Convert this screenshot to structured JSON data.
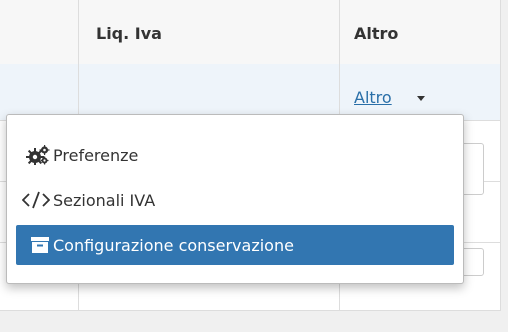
{
  "table": {
    "columns": [
      "Liq. Iva",
      "Altro"
    ]
  },
  "row_action": {
    "label": "Altro"
  },
  "menu": {
    "items": [
      {
        "label": "Preferenze",
        "icon": "cogs-icon"
      },
      {
        "label": "Sezionali IVA",
        "icon": "code-icon"
      },
      {
        "label": "Configurazione conservazione",
        "icon": "archive-icon"
      }
    ]
  },
  "colors": {
    "active": "#3276b1",
    "link": "#2a6fa8"
  }
}
